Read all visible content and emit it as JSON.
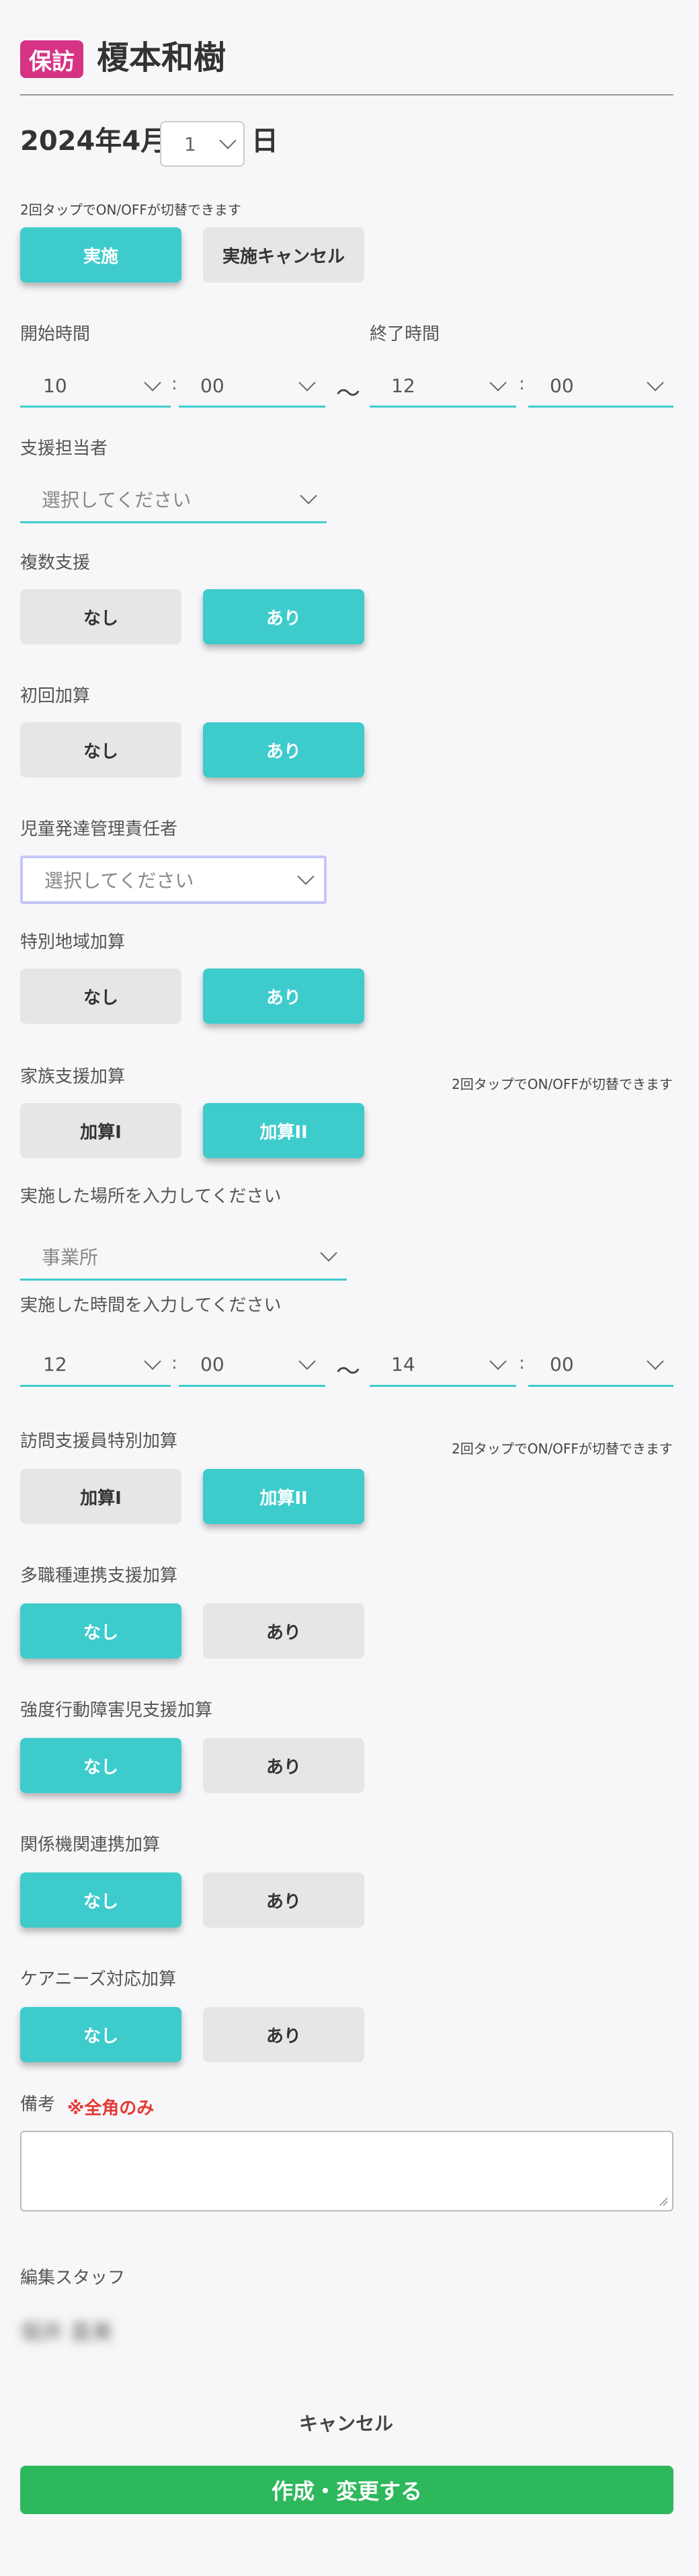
{
  "header": {
    "badge": "保訪",
    "name": "榎本和樹"
  },
  "date": {
    "year_month": "2024年4月",
    "day": "1",
    "day_suffix": "日"
  },
  "top_note": "2回タップでON/OFFが切替できます",
  "status": {
    "implemented": "実施",
    "cancel": "実施キャンセル"
  },
  "time": {
    "start_label": "開始時間",
    "end_label": "終了時間",
    "start_hour": "10",
    "start_min": "00",
    "end_hour": "12",
    "end_min": "00",
    "sep": ":",
    "tilde": "～"
  },
  "staff": {
    "label": "支援担当者",
    "placeholder": "選択してください"
  },
  "multi": {
    "label": "複数支援",
    "no": "なし",
    "yes": "あり"
  },
  "first": {
    "label": "初回加算",
    "no": "なし",
    "yes": "あり"
  },
  "manager": {
    "label": "児童発達管理責任者",
    "placeholder": "選択してください"
  },
  "region": {
    "label": "特別地域加算",
    "no": "なし",
    "yes": "あり"
  },
  "family": {
    "label": "家族支援加算",
    "note": "2回タップでON/OFFが切替できます",
    "opt1": "加算I",
    "opt2": "加算II",
    "place_label": "実施した場所を入力してください",
    "place_value": "事業所",
    "time_label": "実施した時間を入力してください",
    "start_hour": "12",
    "start_min": "00",
    "end_hour": "14",
    "end_min": "00"
  },
  "visit": {
    "label": "訪問支援員特別加算",
    "note": "2回タップでON/OFFが切替できます",
    "opt1": "加算I",
    "opt2": "加算II"
  },
  "multi_job": {
    "label": "多職種連携支援加算",
    "no": "なし",
    "yes": "あり"
  },
  "behavior": {
    "label": "強度行動障害児支援加算",
    "no": "なし",
    "yes": "あり"
  },
  "agency": {
    "label": "関係機関連携加算",
    "no": "なし",
    "yes": "あり"
  },
  "care": {
    "label": "ケアニーズ対応加算",
    "no": "なし",
    "yes": "あり"
  },
  "remarks": {
    "label": "備考",
    "note": "※全角のみ"
  },
  "editor": {
    "label": "編集スタッフ",
    "name": "堀井 直美"
  },
  "actions": {
    "cancel": "キャンセル",
    "submit": "作成・変更する"
  },
  "colors": {
    "accent": "#3ecbcc",
    "badge": "#d63384",
    "submit": "#2eb85c",
    "warning": "#e53935"
  }
}
